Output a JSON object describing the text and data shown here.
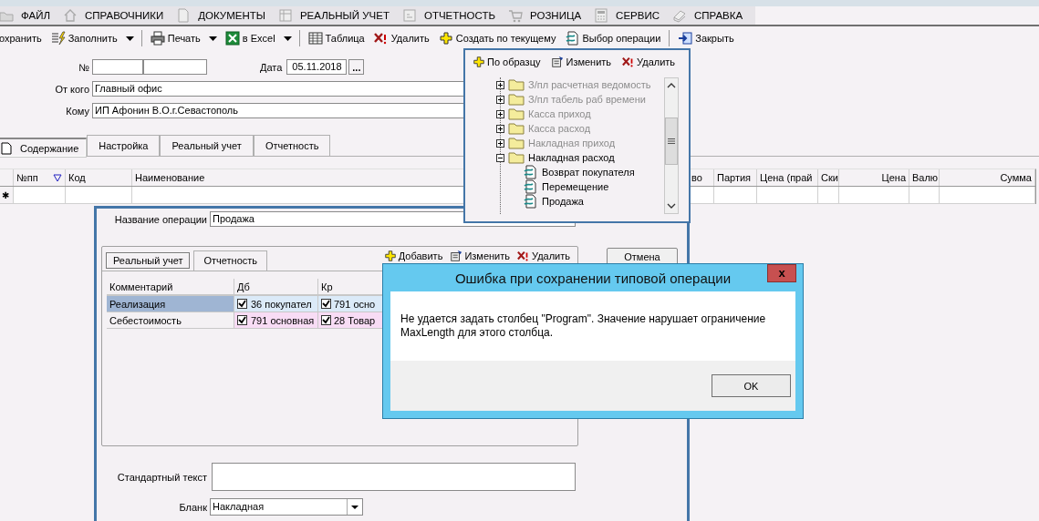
{
  "menu": [
    {
      "label": "ФАЙЛ"
    },
    {
      "label": "СПРАВОЧНИКИ"
    },
    {
      "label": "ДОКУМЕНТЫ"
    },
    {
      "label": "РЕАЛЬНЫЙ УЧЕТ"
    },
    {
      "label": "ОТЧЕТНОСТЬ"
    },
    {
      "label": "РОЗНИЦА"
    },
    {
      "label": "СЕРВИС"
    },
    {
      "label": "СПРАВКА"
    }
  ],
  "toolbar": {
    "groups": [
      [
        {
          "label": "охранить",
          "dropdown": false
        },
        {
          "label": "Заполнить",
          "dropdown": true
        }
      ],
      [
        {
          "label": "Печать",
          "dropdown": true
        },
        {
          "label": "в Excel",
          "dropdown": true
        }
      ],
      [
        {
          "label": "Таблица",
          "dropdown": false
        },
        {
          "label": "Удалить",
          "dropdown": false
        },
        {
          "label": "Создать по текущему",
          "dropdown": false
        },
        {
          "label": "Выбор операции",
          "dropdown": false
        }
      ],
      [
        {
          "label": "Закрыть",
          "dropdown": false
        }
      ]
    ]
  },
  "form": {
    "number_label": "№",
    "date_label": "Дата",
    "date": "05.11.2018",
    "date_button": "...",
    "from_label": "От кого",
    "from": "Главный офис",
    "to_label": "Кому",
    "to": "ИП Афонин В.О.г.Севастополь"
  },
  "tabs": [
    {
      "label": "Содержание",
      "selected": true
    },
    {
      "label": "Настройка",
      "selected": false
    },
    {
      "label": "Реальный учет",
      "selected": false
    },
    {
      "label": "Отчетность",
      "selected": false
    }
  ],
  "grid": {
    "columns": [
      "№пп",
      "Код",
      "Наименование",
      "во",
      "Партия",
      "Цена (прай",
      "Ски",
      "Цена",
      "Валю",
      "Сумма"
    ],
    "new_row_marker": "✱"
  },
  "tree_popup": {
    "toolbar": [
      "По образцу",
      "Изменить",
      "Удалить"
    ],
    "items": [
      {
        "kind": "folder",
        "label": "З/пл расчетная ведомость",
        "disabled": true,
        "expanded": false
      },
      {
        "kind": "folder",
        "label": "З/пл табель раб времени",
        "disabled": true,
        "expanded": false
      },
      {
        "kind": "folder",
        "label": "Касса приход",
        "disabled": true,
        "expanded": false
      },
      {
        "kind": "folder",
        "label": "Касса расход",
        "disabled": true,
        "expanded": false
      },
      {
        "kind": "folder",
        "label": "Накладная приход",
        "disabled": true,
        "expanded": false
      },
      {
        "kind": "folder",
        "label": "Накладная расход",
        "disabled": false,
        "expanded": true,
        "children": [
          {
            "kind": "operation",
            "label": "Возврат покупателя",
            "disabled": false
          },
          {
            "kind": "operation",
            "label": "Перемещение",
            "disabled": false
          },
          {
            "kind": "operation",
            "label": "Продажа",
            "disabled": false
          }
        ]
      }
    ]
  },
  "operation_dialog": {
    "name_label": "Название операции",
    "name": "Продажа",
    "tabs": [
      {
        "label": "Реальный учет",
        "selected": true
      },
      {
        "label": "Отчетность",
        "selected": false
      }
    ],
    "toolbar": [
      "Добавить",
      "Изменить",
      "Удалить"
    ],
    "cancel_button": "Отмена",
    "table": {
      "columns": [
        "Комментарий",
        "Дб",
        "Кр"
      ],
      "rows": [
        {
          "comment": "Реализация",
          "selected": true,
          "color": "#dbeaf8",
          "debit": {
            "checked": true,
            "text": "36 покупател"
          },
          "credit": {
            "checked": true,
            "text": "791 осно"
          }
        },
        {
          "comment": "Себестоимость",
          "selected": false,
          "color": "#f8dcf5",
          "debit": {
            "checked": true,
            "text": "791 основная"
          },
          "credit": {
            "checked": true,
            "text": "28 Товар"
          }
        }
      ]
    },
    "standard_text_label": "Стандартный текст",
    "blank_label": "Бланк",
    "blank": "Накладная"
  },
  "error_dialog": {
    "title": "Ошибка при сохранении типовой операции",
    "close": "x",
    "message": "Не удается задать столбец \"Program\". Значение нарушает ограничение MaxLength для этого столбца.",
    "ok_button": "OK"
  }
}
